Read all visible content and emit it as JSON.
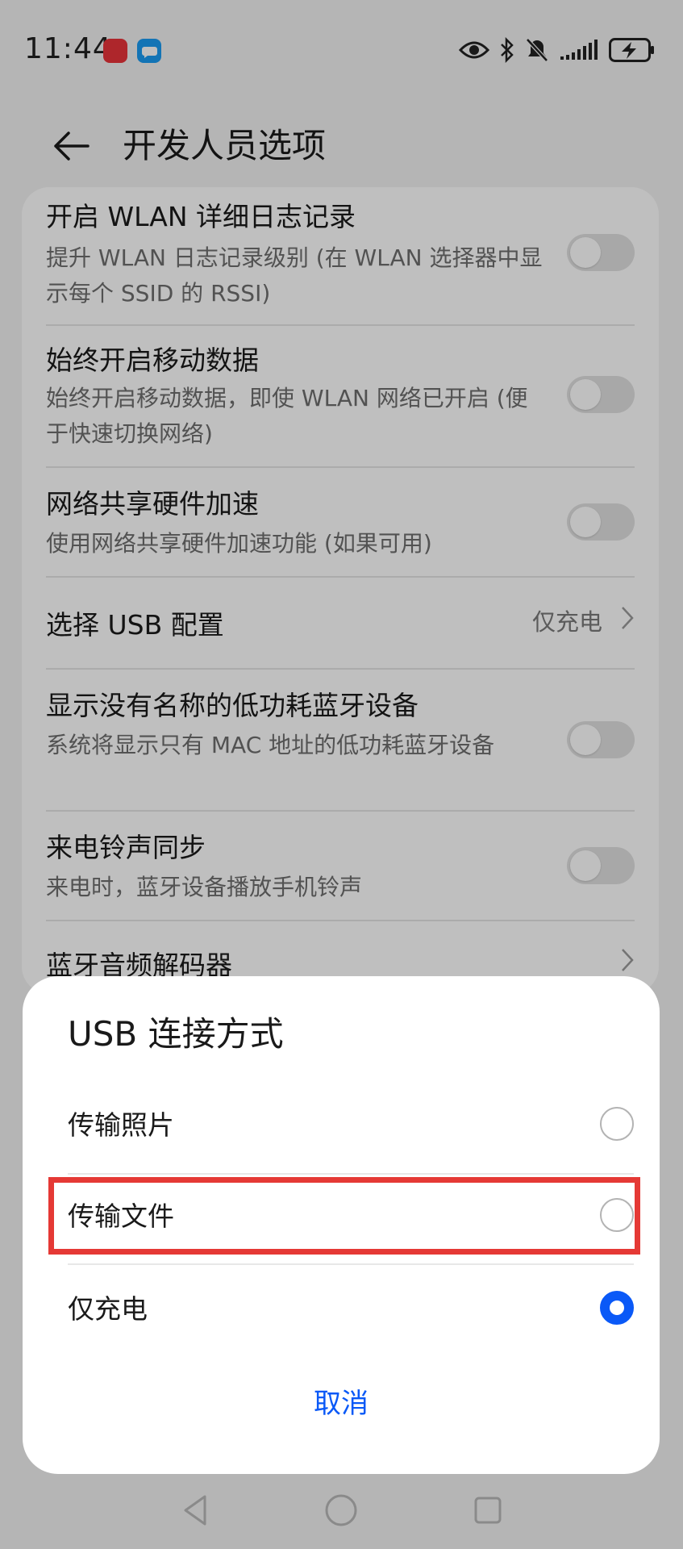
{
  "status_bar": {
    "time": "11:44",
    "icons": [
      "huawei-app-notification-icon",
      "message-notification-icon",
      "eye-comfort-icon",
      "bluetooth-icon",
      "mute-icon",
      "signal-icon",
      "battery-charging-icon"
    ]
  },
  "header": {
    "title": "开发人员选项",
    "back_icon": "arrow-left-icon"
  },
  "settings": {
    "items": [
      {
        "title": "开启 WLAN 详细日志记录",
        "summary": "提升 WLAN 日志记录级别 (在 WLAN 选择器中显示每个 SSID 的 RSSI)",
        "toggle": "off"
      },
      {
        "title": "始终开启移动数据",
        "summary": "始终开启移动数据，即使 WLAN 网络已开启 (便于快速切换网络)",
        "toggle": "off"
      },
      {
        "title": "网络共享硬件加速",
        "summary": "使用网络共享硬件加速功能 (如果可用)",
        "toggle": "off"
      },
      {
        "title": "选择 USB 配置",
        "value": "仅充电"
      },
      {
        "title": "显示没有名称的低功耗蓝牙设备",
        "summary": "系统将显示只有 MAC 地址的低功耗蓝牙设备",
        "toggle": "off"
      },
      {
        "title": "来电铃声同步",
        "summary": "来电时，蓝牙设备播放手机铃声",
        "toggle": "off"
      },
      {
        "title": "蓝牙音频解码器"
      }
    ]
  },
  "dialog": {
    "title": "USB 连接方式",
    "options": [
      {
        "label": "传输照片",
        "selected": false
      },
      {
        "label": "传输文件",
        "selected": false,
        "highlighted": true
      },
      {
        "label": "仅充电",
        "selected": true
      }
    ],
    "cancel_label": "取消"
  },
  "colors": {
    "accent": "#0a59f7",
    "highlight_border": "#e53935",
    "overlay": "rgba(0,0,0,0.25)"
  },
  "nav_bar": {
    "icons": [
      "back-triangle-icon",
      "home-circle-icon",
      "recents-square-icon"
    ]
  }
}
